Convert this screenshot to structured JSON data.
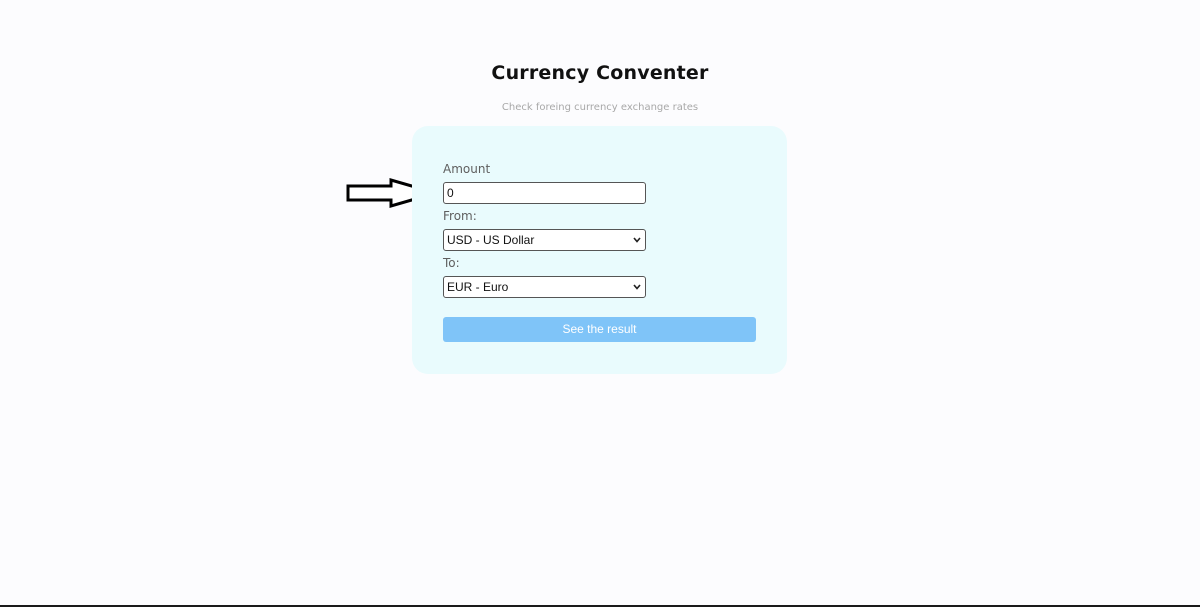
{
  "header": {
    "title": "Currency Conventer",
    "subtitle": "Check foreing currency exchange rates"
  },
  "form": {
    "amount_label": "Amount",
    "amount_value": "0",
    "from_label": "From:",
    "from_value": "USD - US Dollar",
    "to_label": "To:",
    "to_value": "EUR - Euro",
    "submit_label": "See the result"
  },
  "annotation": {
    "arrow_icon": "right-arrow-outline",
    "points_to": "amount-input"
  },
  "colors": {
    "page_background": "#fcfcfe",
    "card_background": "#e9fbfd",
    "button_background": "#7fc4f8",
    "button_text": "#ffffff"
  }
}
